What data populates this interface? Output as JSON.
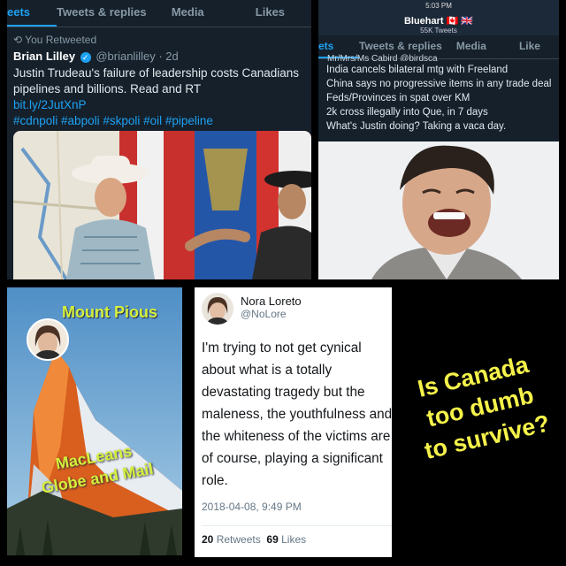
{
  "panel1": {
    "tabs": [
      "eets",
      "Tweets & replies",
      "Media",
      "Likes"
    ],
    "retweet_label": "You Retweeted",
    "author_name": "Brian Lilley",
    "author_handle": "@brianlilley",
    "time": "· 2d",
    "text": "Justin Trudeau's failure of leadership costs Canadians pipelines and billions. Read and RT",
    "link": "bit.ly/2JutXnP",
    "hashtags": "#cdnpoli #abpoli #skpoli #oil #pipeline"
  },
  "panel2": {
    "clock": "5:03 PM",
    "profile_name": "Bluehart 🇨🇦 🇬🇧",
    "tweet_count": "55K Tweets",
    "cut_header": "Mr/Mrs/Ms Cabird @birdsca",
    "tabs": [
      "ets",
      "Tweets & replies",
      "Media",
      "Like"
    ],
    "lines": [
      "India cancels bilateral mtg with Freeland",
      "China says no progressive items in any trade deal",
      "Feds/Provinces in spat over KM",
      "2k cross illegally into Que, in 7 days",
      "What's Justin doing? Taking a vaca day."
    ]
  },
  "panel3": {
    "title": "Mount Pious",
    "caption_line1": "MacLeans",
    "caption_line2": "Globe and Mail"
  },
  "panel4": {
    "name": "Nora Loreto",
    "handle": "@NoLore",
    "body": "I'm trying to not get cynical about what is a totally devastating tragedy but the maleness, the youthfulness and the whiteness of the victims are of course, playing a significant role.",
    "date": "2018-04-08, 9:49 PM",
    "retweets_count": "20",
    "retweets_label": "Retweets",
    "likes_count": "69",
    "likes_label": "Likes"
  },
  "overlay": {
    "line1": "Is Canada",
    "line2": "too dumb",
    "line3": "to survive?"
  },
  "colors": {
    "twitter_blue": "#1da1f2",
    "dark_bg": "#15202b",
    "overlay_yellow": "#f5f24a"
  }
}
